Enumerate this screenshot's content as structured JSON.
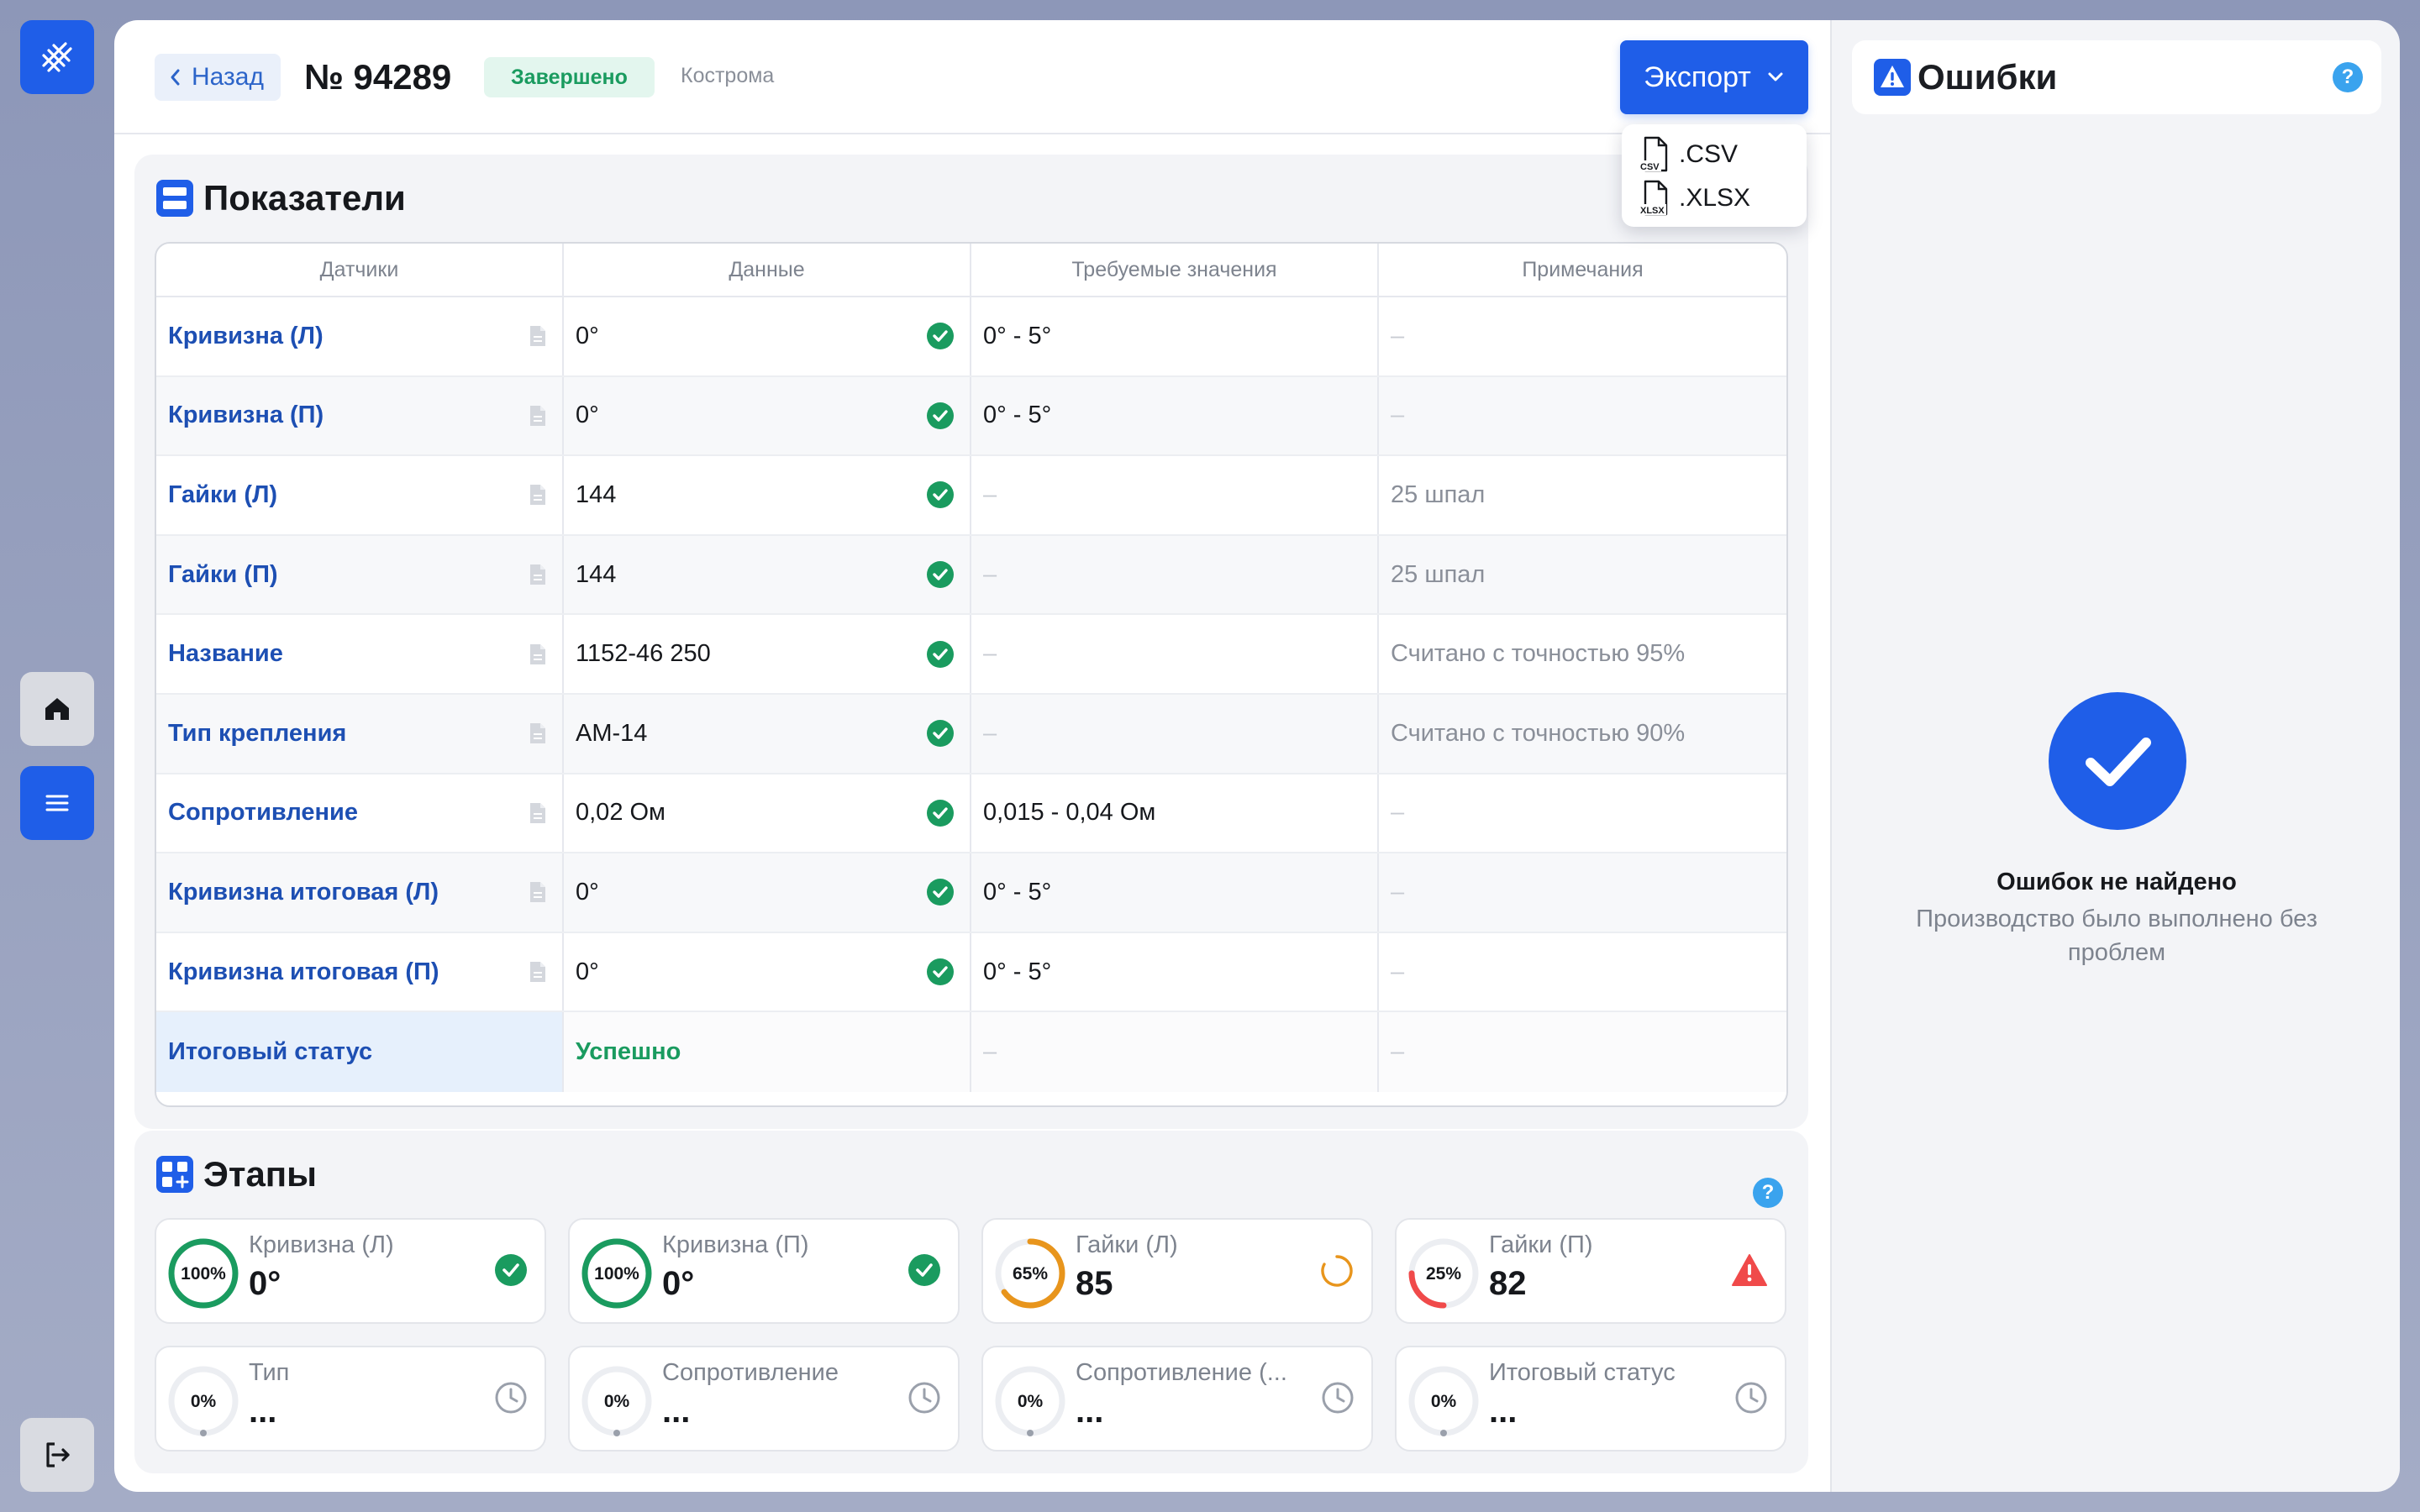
{
  "header": {
    "back_label": "Назад",
    "order_title": "№ 94289",
    "status": "Завершено",
    "city": "Кострома",
    "export_label": "Экспорт",
    "export_options": [
      ".CSV",
      ".XLSX"
    ],
    "export_icon_tags": [
      "CSV",
      "XLSX"
    ]
  },
  "metrics": {
    "title": "Показатели",
    "columns": [
      "Датчики",
      "Данные",
      "Требуемые значения",
      "Примечания"
    ],
    "rows": [
      {
        "name": "Кривизна (Л)",
        "data": "0°",
        "required": "0° - 5°",
        "note": "–"
      },
      {
        "name": "Кривизна (П)",
        "data": "0°",
        "required": "0° - 5°",
        "note": "–"
      },
      {
        "name": "Гайки (Л)",
        "data": "144",
        "required": "–",
        "note": "25 шпал"
      },
      {
        "name": "Гайки (П)",
        "data": "144",
        "required": "–",
        "note": "25 шпал"
      },
      {
        "name": "Название",
        "data": "1152-46 250",
        "required": "–",
        "note": "Считано с точностью 95%"
      },
      {
        "name": "Тип крепления",
        "data": "АМ-14",
        "required": "–",
        "note": "Считано с точностью 90%"
      },
      {
        "name": "Сопротивление",
        "data": "0,02 Ом",
        "required": "0,015 - 0,04 Ом",
        "note": "–"
      },
      {
        "name": "Кривизна итоговая (Л)",
        "data": "0°",
        "required": "0° - 5°",
        "note": "–"
      },
      {
        "name": "Кривизна итоговая (П)",
        "data": "0°",
        "required": "0° - 5°",
        "note": "–"
      }
    ],
    "final": {
      "name": "Итоговый статус",
      "data": "Успешно",
      "required": "–",
      "note": "–"
    }
  },
  "stages": {
    "title": "Этапы",
    "items": [
      {
        "label": "Кривизна (Л)",
        "value": "0°",
        "percent": 100,
        "percent_label": "100%",
        "state": "done"
      },
      {
        "label": "Кривизна (П)",
        "value": "0°",
        "percent": 100,
        "percent_label": "100%",
        "state": "done"
      },
      {
        "label": "Гайки (Л)",
        "value": "85",
        "percent": 65,
        "percent_label": "65%",
        "state": "progress"
      },
      {
        "label": "Гайки (П)",
        "value": "82",
        "percent": 25,
        "percent_label": "25%",
        "state": "error"
      },
      {
        "label": "Тип",
        "value": "...",
        "percent": 0,
        "percent_label": "0%",
        "state": "pending"
      },
      {
        "label": "Сопротивление",
        "value": "...",
        "percent": 0,
        "percent_label": "0%",
        "state": "pending"
      },
      {
        "label": "Сопротивление (...",
        "value": "...",
        "percent": 0,
        "percent_label": "0%",
        "state": "pending"
      },
      {
        "label": "Итоговый статус",
        "value": "...",
        "percent": 0,
        "percent_label": "0%",
        "state": "pending"
      }
    ]
  },
  "errors": {
    "title": "Ошибки",
    "help": "?",
    "empty_title": "Ошибок не найдено",
    "empty_subtitle": "Производство было выполнено без проблем"
  },
  "colors": {
    "accent": "#1f5ee8",
    "success": "#1a9b5f",
    "warning": "#e8951c",
    "error": "#f04a4a",
    "link": "#1d4fb3"
  }
}
